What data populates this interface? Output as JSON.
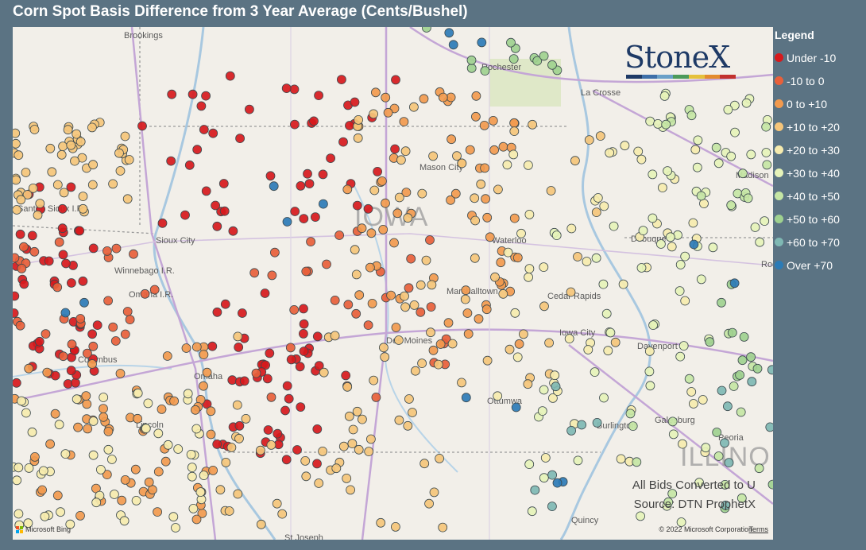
{
  "title": "Corn Spot Basis Difference from 3 Year Average (Cents/Bushel)",
  "legend": {
    "title": "Legend",
    "items": [
      {
        "label": "Under -10",
        "color": "#d7191c"
      },
      {
        "label": "-10 to 0",
        "color": "#e8603a"
      },
      {
        "label": "0 to +10",
        "color": "#f29a4e"
      },
      {
        "label": "+10 to +20",
        "color": "#f5c57a"
      },
      {
        "label": "+20 to +30",
        "color": "#f6ebae"
      },
      {
        "label": "+30 to +40",
        "color": "#e6f3b9"
      },
      {
        "label": "+40 to +50",
        "color": "#c5e6a4"
      },
      {
        "label": "+50 to +60",
        "color": "#9fd18f"
      },
      {
        "label": "+60 to +70",
        "color": "#7fb8b3"
      },
      {
        "label": "Over +70",
        "color": "#2c7bb6"
      }
    ]
  },
  "logo": {
    "text": "StoneX",
    "bar_colors": [
      "#1e3a66",
      "#3e6fa8",
      "#6aa0c8",
      "#4c9a5a",
      "#e5c13b",
      "#e38b2d",
      "#c2312f"
    ]
  },
  "source": {
    "line1": "All Bids Converted to U",
    "line2": "Source: DTN ProphetX"
  },
  "attribution": {
    "bing": "Microsoft Bing",
    "copyright": "© 2022 Microsoft Corporation",
    "terms": "Terms",
    "bing_colors": [
      "#f25022",
      "#7fba00",
      "#00a4ef",
      "#ffb900"
    ]
  },
  "map": {
    "state_labels": [
      "IOWA",
      "ILLINO"
    ],
    "cities": [
      "Brookings",
      "Rochester",
      "La Crosse",
      "Mason City",
      "Madison",
      "Sioux City",
      "Waterloo",
      "Dubuque",
      "Winnebago I.R.",
      "Omaha I.R.",
      "Santee Sioux I.R.",
      "Marshalltown",
      "Cedar Rapids",
      "Columbus",
      "Des Moines",
      "Iowa City",
      "Davenport",
      "Omaha",
      "Ottumwa",
      "Galesburg",
      "Burlington",
      "Lincoln",
      "Peoria",
      "Quincy",
      "St Joseph",
      "Rock"
    ],
    "dots_by_class": [
      {
        "class": 9,
        "count": 150
      },
      {
        "class": 8,
        "count": 60
      },
      {
        "class": 7,
        "count": 140
      },
      {
        "class": 6,
        "count": 160
      },
      {
        "class": 5,
        "count": 110
      },
      {
        "class": 4,
        "count": 70
      },
      {
        "class": 3,
        "count": 30
      },
      {
        "class": 2,
        "count": 25
      },
      {
        "class": 1,
        "count": 15
      },
      {
        "class": 0,
        "count": 14
      }
    ]
  }
}
